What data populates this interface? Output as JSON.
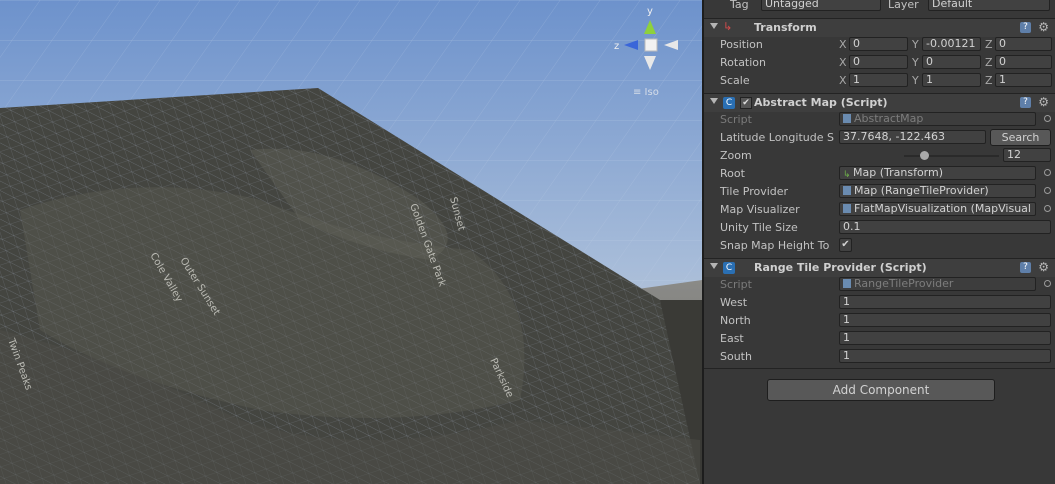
{
  "scene": {
    "iso_label": "≡ Iso",
    "gizmo": {
      "y": "y",
      "z": "z"
    },
    "map_labels": [
      "Golden Gate Park",
      "Sunset",
      "Cole Valley",
      "Outer Sunset",
      "Twin Peaks",
      "Parkside"
    ]
  },
  "inspector": {
    "tag_label": "Tag",
    "tag_value": "Untagged",
    "layer_label": "Layer",
    "layer_value": "Default",
    "transform": {
      "title": "Transform",
      "position": {
        "label": "Position",
        "x": "0",
        "y": "-0.00121",
        "z": "0"
      },
      "rotation": {
        "label": "Rotation",
        "x": "0",
        "y": "0",
        "z": "0"
      },
      "scale": {
        "label": "Scale",
        "x": "1",
        "y": "1",
        "z": "1"
      }
    },
    "abstract_map": {
      "title": "Abstract Map (Script)",
      "script_label": "Script",
      "script_value": "AbstractMap",
      "latlon_label": "Latitude Longitude S",
      "latlon_value": "37.7648, -122.463",
      "search_label": "Search",
      "zoom_label": "Zoom",
      "zoom_value": "12",
      "root_label": "Root",
      "root_value": "Map (Transform)",
      "tile_provider_label": "Tile Provider",
      "tile_provider_value": "Map (RangeTileProvider)",
      "map_visualizer_label": "Map Visualizer",
      "map_visualizer_value": "FlatMapVisualization (MapVisual",
      "unity_tile_size_label": "Unity Tile Size",
      "unity_tile_size_value": "0.1",
      "snap_label": "Snap Map Height To",
      "snap_checked": "✔"
    },
    "range_tile_provider": {
      "title": "Range Tile Provider (Script)",
      "script_label": "Script",
      "script_value": "RangeTileProvider",
      "west_label": "West",
      "west_value": "1",
      "north_label": "North",
      "north_value": "1",
      "east_label": "East",
      "east_value": "1",
      "south_label": "South",
      "south_value": "1"
    },
    "add_component_label": "Add Component",
    "axis_x": "X",
    "axis_y": "Y",
    "axis_z": "Z"
  }
}
